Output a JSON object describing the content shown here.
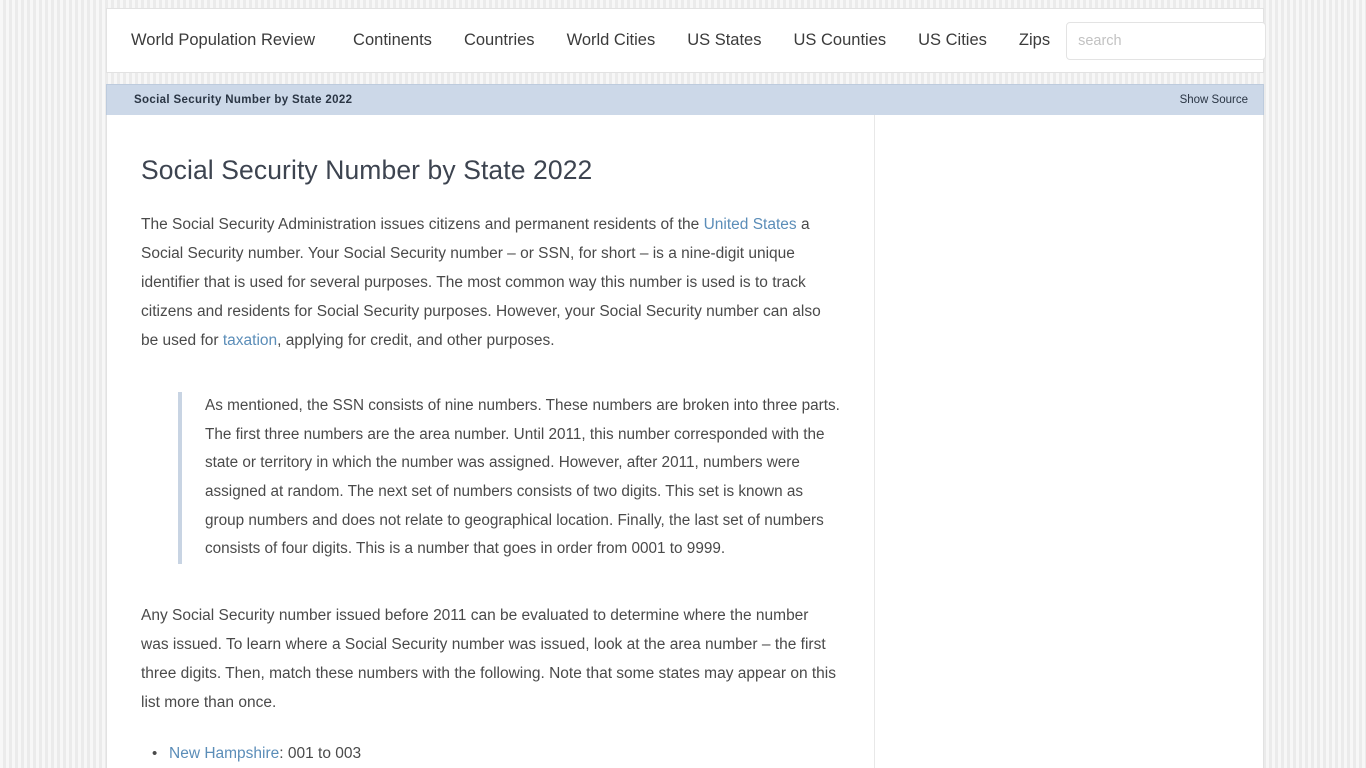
{
  "site": {
    "nav": {
      "items": [
        {
          "label": "World Population Review",
          "name": "nav-item-brand"
        },
        {
          "label": "Continents",
          "name": "nav-item-continents"
        },
        {
          "label": "Countries",
          "name": "nav-item-countries"
        },
        {
          "label": "World Cities",
          "name": "nav-item-world-cities"
        },
        {
          "label": "US States",
          "name": "nav-item-us-states"
        },
        {
          "label": "US Counties",
          "name": "nav-item-us-counties"
        },
        {
          "label": "US Cities",
          "name": "nav-item-us-cities"
        },
        {
          "label": "Zips",
          "name": "nav-item-zips"
        }
      ],
      "search": {
        "placeholder": "search",
        "value": ""
      }
    }
  },
  "titlebar": {
    "label": "Social Security Number by State 2022",
    "action_label": "Show Source",
    "background_color": "#ccd8e8",
    "text_color": "#2a3544"
  },
  "article": {
    "title": "Social Security Number by State 2022",
    "intro": {
      "part1": "The Social Security Administration issues citizens and permanent residents of the ",
      "link1": "United States",
      "part2": " a Social Security number. Your Social Security number – or SSN, for short – is a nine-digit unique identifier that is used for several purposes. The most common way this number is used is to track citizens and residents for Social Security purposes. However, your Social Security number can also be used for ",
      "link2": "taxation",
      "part3": ", applying for credit, and other purposes."
    },
    "callout": "As mentioned, the SSN consists of nine numbers. These numbers are broken into three parts. The first three numbers are the area number. Until 2011, this number corresponded with the state or territory in which the number was assigned. However, after 2011, numbers were assigned at random. The next set of numbers consists of two digits. This set is known as group numbers and does not relate to geographical location. Finally, the last set of numbers consists of four digits. This is a number that goes in order from 0001 to 9999.",
    "paragraph2": "Any Social Security number issued before 2011 can be evaluated to determine where the number was issued. To learn where a Social Security number was issued, look at the area number – the first three digits. Then, match these numbers with the following. Note that some states may appear on this list more than once.",
    "list": [
      {
        "state": "New Hampshire",
        "range": ": 001 to 003"
      }
    ],
    "link_color": "#5b8db8",
    "callout_border_color": "#c8d4e3"
  }
}
